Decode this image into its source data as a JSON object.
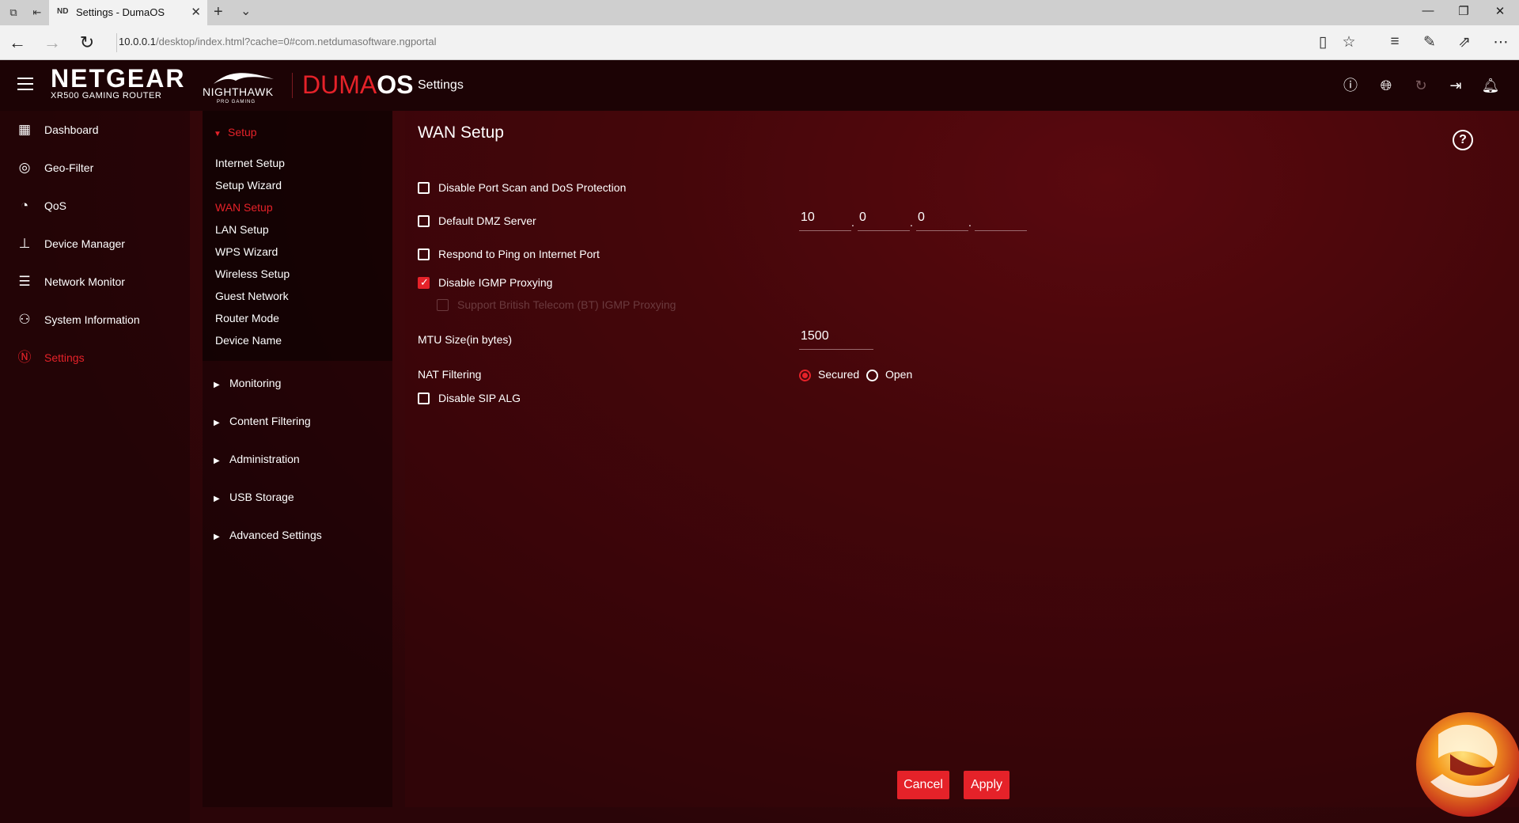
{
  "browser": {
    "tab_title": "Settings - DumaOS",
    "tab_favicon": "ND",
    "url_host": "10.0.0.1",
    "url_path": "/desktop/index.html?cache=0#com.netdumasoftware.ngportal"
  },
  "header": {
    "brand_name": "NETGEAR",
    "brand_sub": "XR500 GAMING ROUTER",
    "nighthawk": "NIGHTHAWK",
    "nighthawk_sub": "PRO GAMING",
    "duma": "DUMA",
    "os": "OS",
    "title": "Settings"
  },
  "leftnav": {
    "items": [
      {
        "label": "Dashboard",
        "icon": "dashboard-icon"
      },
      {
        "label": "Geo-Filter",
        "icon": "geo-filter-icon"
      },
      {
        "label": "QoS",
        "icon": "qos-icon"
      },
      {
        "label": "Device Manager",
        "icon": "device-manager-icon"
      },
      {
        "label": "Network Monitor",
        "icon": "network-monitor-icon"
      },
      {
        "label": "System Information",
        "icon": "system-information-icon"
      },
      {
        "label": "Settings",
        "icon": "settings-icon",
        "active": true
      }
    ]
  },
  "subnav": {
    "open_group": "Setup",
    "items": [
      "Internet Setup",
      "Setup Wizard",
      "WAN Setup",
      "LAN Setup",
      "WPS Wizard",
      "Wireless Setup",
      "Guest Network",
      "Router Mode",
      "Device Name"
    ],
    "active_item": "WAN Setup",
    "groups": [
      "Monitoring",
      "Content Filtering",
      "Administration",
      "USB Storage",
      "Advanced Settings"
    ]
  },
  "main": {
    "title": "WAN Setup",
    "options": {
      "disable_port_scan": {
        "label": "Disable Port Scan and DoS Protection",
        "checked": false
      },
      "default_dmz": {
        "label": "Default DMZ Server",
        "checked": false
      },
      "respond_ping": {
        "label": "Respond to Ping on Internet Port",
        "checked": false
      },
      "disable_igmp": {
        "label": "Disable IGMP Proxying",
        "checked": true
      },
      "support_bt": {
        "label": "Support British Telecom (BT) IGMP Proxying",
        "checked": false,
        "disabled": true
      },
      "disable_sip": {
        "label": "Disable SIP ALG",
        "checked": false
      }
    },
    "dmz_ip": [
      "10",
      "0",
      "0",
      ""
    ],
    "mtu_label": "MTU Size(in bytes)",
    "mtu_value": "1500",
    "nat_label": "NAT Filtering",
    "nat_options": [
      "Secured",
      "Open"
    ],
    "nat_selected": "Secured",
    "cancel_label": "Cancel",
    "apply_label": "Apply"
  },
  "colors": {
    "accent": "#e52229",
    "background": "#2a0508"
  }
}
